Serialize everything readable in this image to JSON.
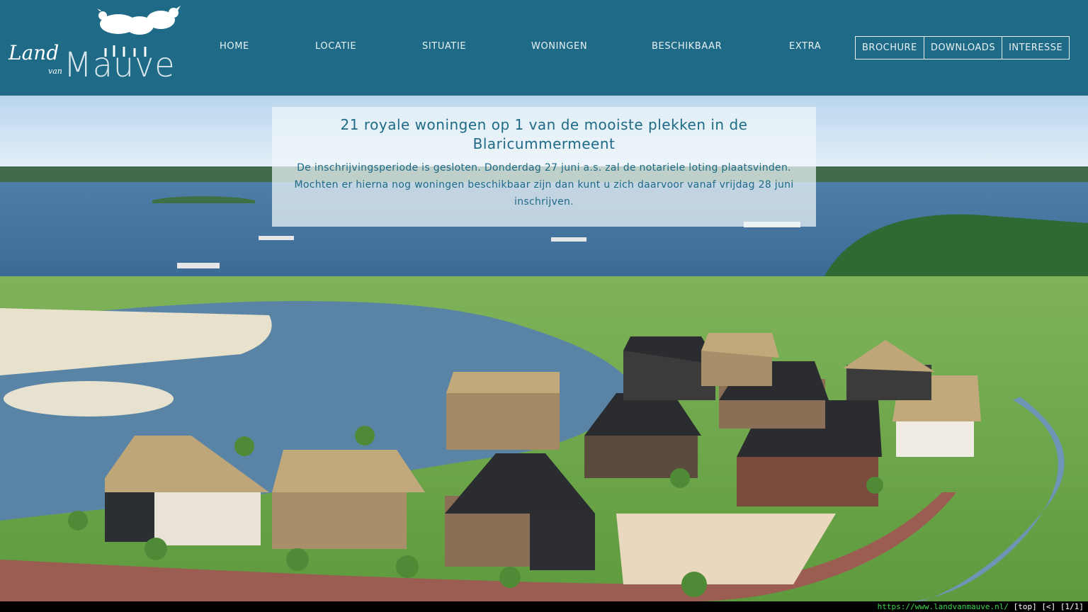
{
  "brand": {
    "logo_land": "Land",
    "logo_van": "van",
    "logo_mauve": "Mauve"
  },
  "nav": {
    "items": [
      {
        "label": "HOME"
      },
      {
        "label": "LOCATIE"
      },
      {
        "label": "SITUATIE"
      },
      {
        "label": "WONINGEN"
      },
      {
        "label": "BESCHIKBAAR"
      },
      {
        "label": "EXTRA"
      }
    ],
    "buttons": [
      {
        "label": "BROCHURE"
      },
      {
        "label": "DOWNLOADS"
      },
      {
        "label": "INTERESSE"
      }
    ]
  },
  "intro": {
    "title": "21 royale woningen op 1 van de mooiste plekken in de Blaricummermeent",
    "text": "De inschrijvingsperiode is gesloten. Donderdag 27 juni a.s. zal de notariele loting plaatsvinden. Mochten er hierna nog woningen beschikbaar zijn dan kunt u zich daarvoor vanaf vrijdag 28 juni inschrijven."
  },
  "statusbar": {
    "url": "https://www.landvanmauve.nl/",
    "nav": "[top] [<] [1/1]"
  },
  "colors": {
    "header_bg": "#1f6a86",
    "text_accent": "#1f6a86",
    "nav_text": "#e8f1f5"
  }
}
